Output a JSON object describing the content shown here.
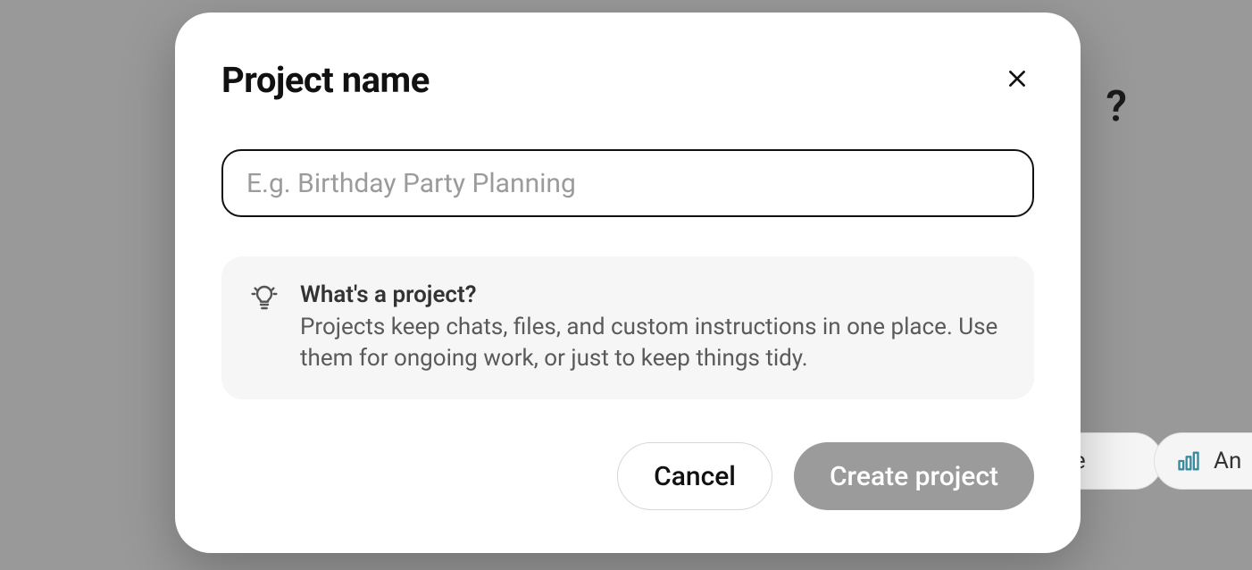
{
  "modal": {
    "title": "Project name",
    "input": {
      "placeholder": "E.g. Birthday Party Planning",
      "value": ""
    },
    "info": {
      "title": "What's a project?",
      "body": "Projects keep chats, files, and custom instructions in one place. Use them for ongoing work, or just to keep things tidy."
    },
    "buttons": {
      "cancel": "Cancel",
      "create": "Create project"
    }
  },
  "background": {
    "text_fragment": "?",
    "pill_one_label": "ite",
    "pill_two_label": "An"
  }
}
